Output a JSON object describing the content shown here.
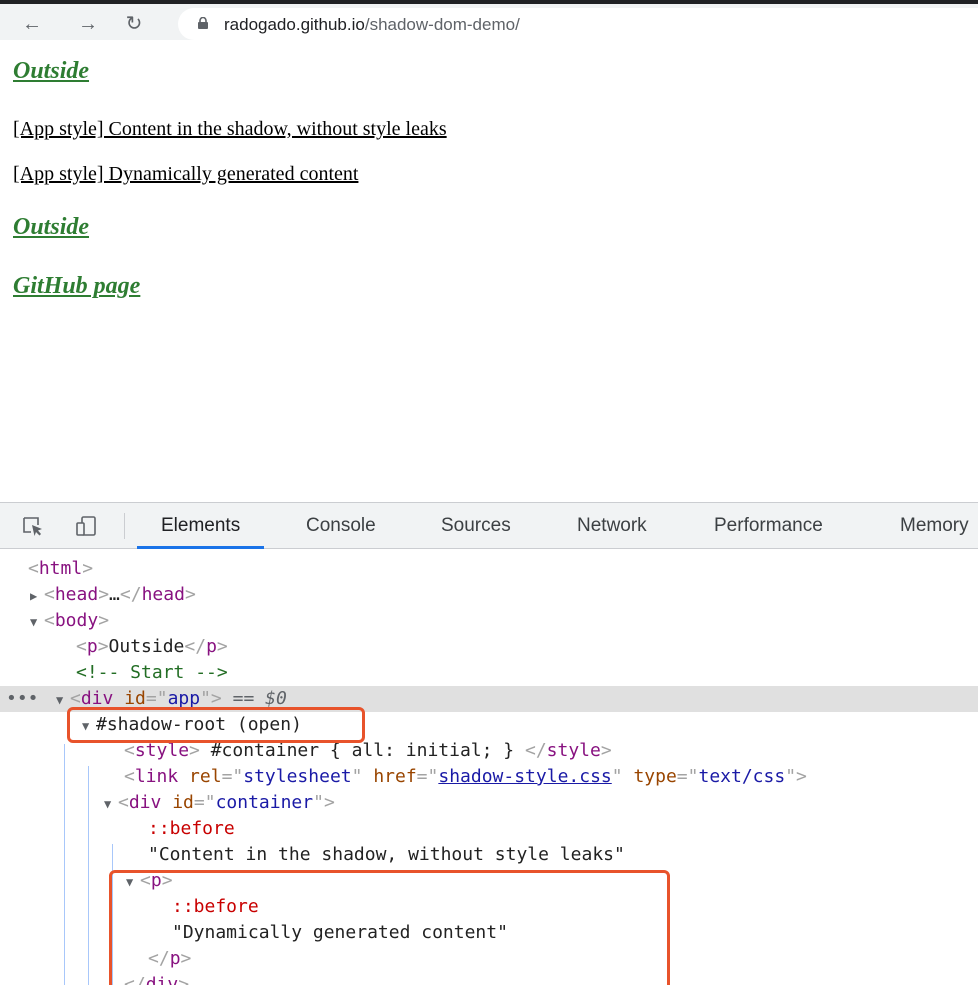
{
  "browser": {
    "back_icon": "arrow-left",
    "forward_icon": "arrow-right",
    "reload_icon": "reload",
    "lock_icon": "lock",
    "url_host": "radogado.github.io",
    "url_path": "/shadow-dom-demo/"
  },
  "page": {
    "outside_1": "Outside",
    "app_line_1": "[App style] Content in the shadow, without style leaks",
    "app_line_2": "[App style] Dynamically generated content",
    "outside_2": "Outside",
    "github_link": "GitHub page",
    "link_color": "#2e7d32"
  },
  "devtools": {
    "tabs": [
      "Elements",
      "Console",
      "Sources",
      "Network",
      "Performance",
      "Memory"
    ],
    "active_tab": "Elements",
    "tree": {
      "html": "html",
      "head": "head",
      "head_ellipsis": "…",
      "body": "body",
      "p_outside": "Outside",
      "comment": "<!-- Start -->",
      "div_app_id": "app",
      "selected_marker": "== $0",
      "shadow_root": "#shadow-root (open)",
      "style_content": " #container { all: initial; } ",
      "link_rel": "stylesheet",
      "link_href": "shadow-style.css",
      "link_type": "text/css",
      "div_container_id": "container",
      "before": "::before",
      "text_1": "\"Content in the shadow, without style leaks\"",
      "before_2": "::before",
      "text_2": "\"Dynamically generated content\""
    },
    "highlight_color": "#e8532b",
    "selection_color": "#e0e0e0"
  }
}
